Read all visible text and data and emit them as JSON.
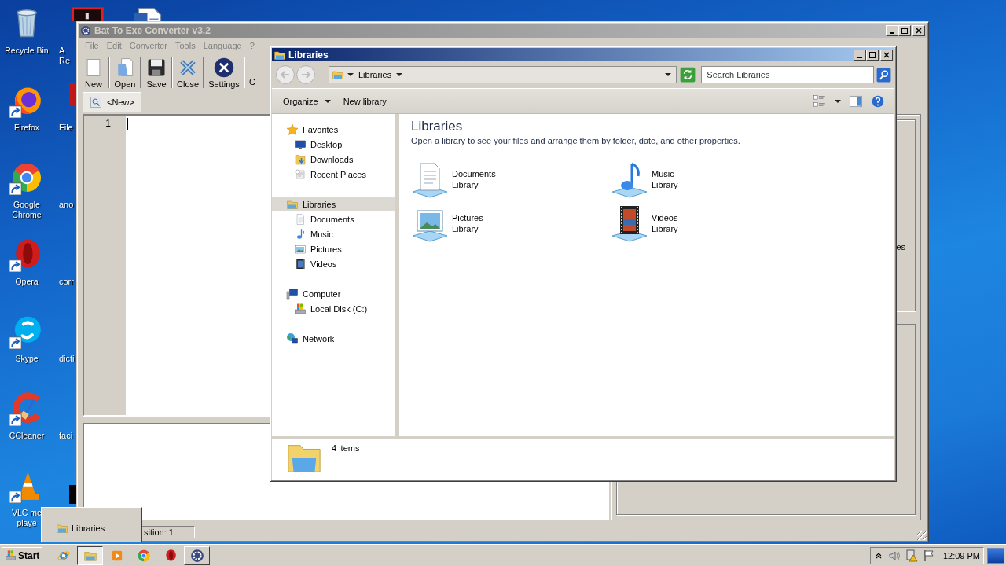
{
  "desktop": {
    "icons": [
      {
        "label": "Recycle Bin"
      },
      {
        "label": "Firefox"
      },
      {
        "label": "Google Chrome"
      },
      {
        "label": "Opera"
      },
      {
        "label": "Skype"
      },
      {
        "label": "CCleaner"
      },
      {
        "label": "VLC me\nplaye"
      }
    ],
    "partial_labels": [
      "A\nRe",
      "File",
      "ano",
      "corr",
      "dicti",
      "faci"
    ]
  },
  "converter": {
    "title": "Bat To Exe Converter v3.2",
    "menu": [
      "File",
      "Edit",
      "Converter",
      "Tools",
      "Language",
      "?"
    ],
    "toolbar": [
      "New",
      "Open",
      "Save",
      "Close",
      "Settings",
      "C"
    ],
    "tabs": [
      {
        "label": "<New>",
        "selected": true
      }
    ],
    "line_numbers": [
      "1"
    ],
    "side_text": "es",
    "status": "sition: 1"
  },
  "explorer": {
    "title": "Libraries",
    "address": "Libraries",
    "search": {
      "placeholder": "Search Libraries"
    },
    "commands": [
      "Organize",
      "New library"
    ],
    "navigation": [
      {
        "label": "Favorites",
        "selected": false,
        "children": [
          {
            "label": "Desktop",
            "selected": false
          },
          {
            "label": "Downloads",
            "selected": false
          },
          {
            "label": "Recent Places",
            "selected": false
          }
        ]
      },
      {
        "label": "Libraries",
        "selected": true,
        "children": [
          {
            "label": "Documents",
            "selected": false
          },
          {
            "label": "Music",
            "selected": false
          },
          {
            "label": "Pictures",
            "selected": false
          },
          {
            "label": "Videos",
            "selected": false
          }
        ]
      },
      {
        "label": "Computer",
        "selected": false,
        "children": [
          {
            "label": "Local Disk (C:)",
            "selected": false
          }
        ]
      },
      {
        "label": "Network",
        "selected": false
      }
    ],
    "heading": "Libraries",
    "description": "Open a library to see your files and arrange them by folder, date, and other properties.",
    "libraries": [
      {
        "name": "Documents",
        "type": "Library"
      },
      {
        "name": "Music",
        "type": "Library"
      },
      {
        "name": "Pictures",
        "type": "Library"
      },
      {
        "name": "Videos",
        "type": "Library"
      }
    ],
    "status": "4 items"
  },
  "taskbar": {
    "start": "Start",
    "apps": [
      {
        "active": false,
        "running": false
      },
      {
        "active": true
      },
      {
        "active": false,
        "running": false
      },
      {
        "active": false,
        "running": false
      },
      {
        "active": false,
        "running": false
      },
      {
        "active": false,
        "running": true
      }
    ],
    "clock": "12:09 PM"
  },
  "thumbnail": {
    "title": "Libraries"
  }
}
